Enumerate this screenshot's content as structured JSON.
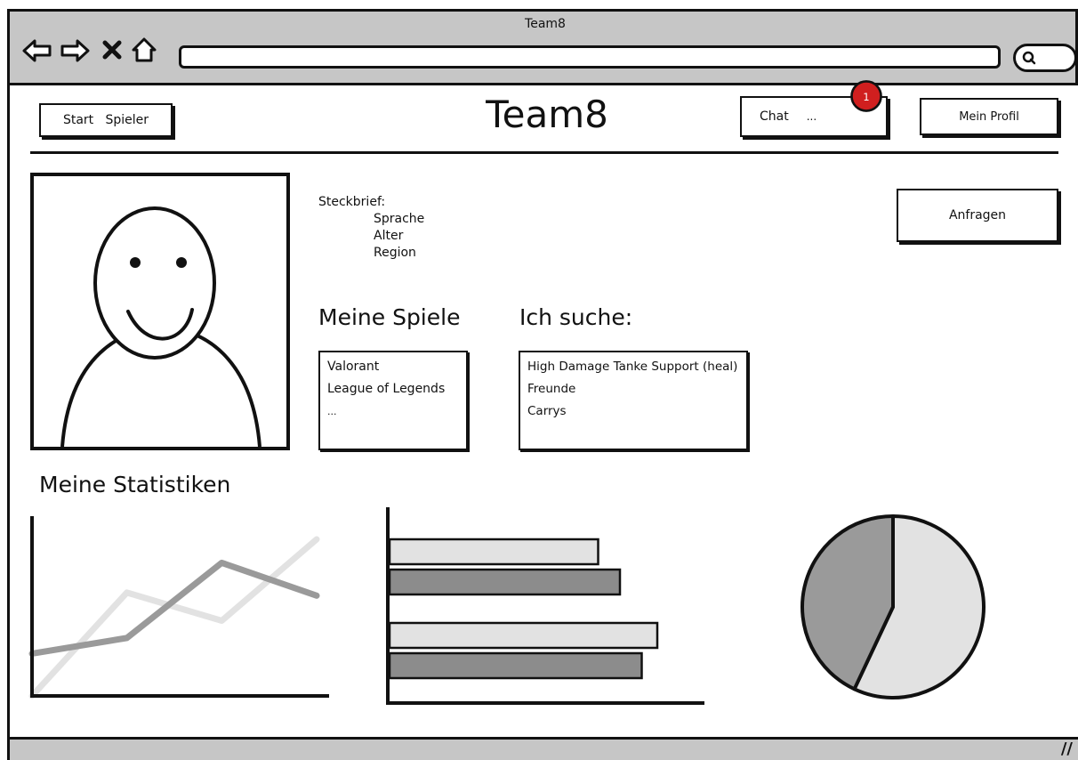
{
  "window": {
    "title": "Team8"
  },
  "header": {
    "nav_label": "Start   Spieler",
    "brand": "Team8",
    "chat_label": "Chat",
    "chat_preview": "...",
    "chat_badge": "1",
    "profile_label": "Mein Profil"
  },
  "profile": {
    "card_title": "Steckbrief:",
    "fields": [
      "Sprache",
      "Alter",
      "Region"
    ],
    "request_label": "Anfragen"
  },
  "games": {
    "heading": "Meine Spiele",
    "items": [
      "Valorant",
      "League of Legends",
      "..."
    ]
  },
  "looking_for": {
    "heading": "Ich suche:",
    "items": [
      "High Damage Tanke Support (heal)",
      "Freunde",
      "Carrys"
    ]
  },
  "stats": {
    "heading": "Meine Statistiken"
  },
  "colors": {
    "chrome": "#c6c6c6",
    "badge": "#d01f1f",
    "light": "#e2e2e2",
    "mid": "#9a9a9a",
    "dark": "#8c8c8c"
  },
  "chart_data": [
    {
      "type": "line",
      "x": [
        0,
        1,
        2,
        3
      ],
      "series": [
        {
          "values": [
            0,
            66,
            48,
            100
          ]
        },
        {
          "values": [
            27,
            37,
            85,
            64
          ]
        }
      ],
      "ylim": [
        0,
        100
      ]
    },
    {
      "type": "bar",
      "orientation": "horizontal",
      "categories": [
        "",
        "",
        "",
        ""
      ],
      "values": [
        67,
        74,
        86,
        81
      ],
      "xlim": [
        0,
        100
      ]
    },
    {
      "type": "pie",
      "values": [
        57,
        43
      ]
    }
  ]
}
